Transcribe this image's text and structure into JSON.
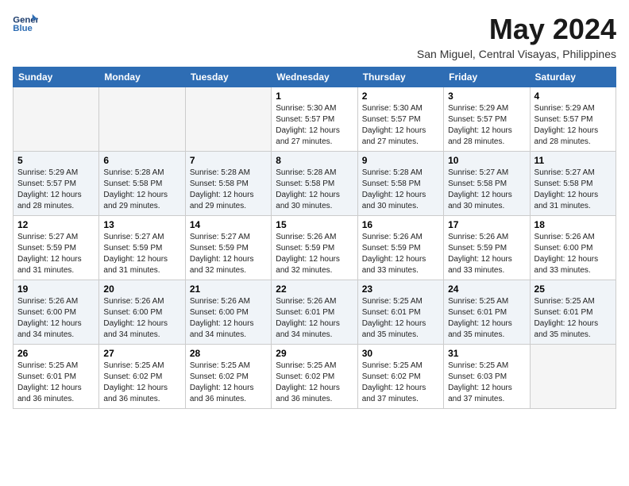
{
  "logo": {
    "line1": "General",
    "line2": "Blue"
  },
  "title": "May 2024",
  "subtitle": "San Miguel, Central Visayas, Philippines",
  "weekdays": [
    "Sunday",
    "Monday",
    "Tuesday",
    "Wednesday",
    "Thursday",
    "Friday",
    "Saturday"
  ],
  "weeks": [
    [
      {
        "day": "",
        "info": ""
      },
      {
        "day": "",
        "info": ""
      },
      {
        "day": "",
        "info": ""
      },
      {
        "day": "1",
        "info": "Sunrise: 5:30 AM\nSunset: 5:57 PM\nDaylight: 12 hours\nand 27 minutes."
      },
      {
        "day": "2",
        "info": "Sunrise: 5:30 AM\nSunset: 5:57 PM\nDaylight: 12 hours\nand 27 minutes."
      },
      {
        "day": "3",
        "info": "Sunrise: 5:29 AM\nSunset: 5:57 PM\nDaylight: 12 hours\nand 28 minutes."
      },
      {
        "day": "4",
        "info": "Sunrise: 5:29 AM\nSunset: 5:57 PM\nDaylight: 12 hours\nand 28 minutes."
      }
    ],
    [
      {
        "day": "5",
        "info": "Sunrise: 5:29 AM\nSunset: 5:57 PM\nDaylight: 12 hours\nand 28 minutes."
      },
      {
        "day": "6",
        "info": "Sunrise: 5:28 AM\nSunset: 5:58 PM\nDaylight: 12 hours\nand 29 minutes."
      },
      {
        "day": "7",
        "info": "Sunrise: 5:28 AM\nSunset: 5:58 PM\nDaylight: 12 hours\nand 29 minutes."
      },
      {
        "day": "8",
        "info": "Sunrise: 5:28 AM\nSunset: 5:58 PM\nDaylight: 12 hours\nand 30 minutes."
      },
      {
        "day": "9",
        "info": "Sunrise: 5:28 AM\nSunset: 5:58 PM\nDaylight: 12 hours\nand 30 minutes."
      },
      {
        "day": "10",
        "info": "Sunrise: 5:27 AM\nSunset: 5:58 PM\nDaylight: 12 hours\nand 30 minutes."
      },
      {
        "day": "11",
        "info": "Sunrise: 5:27 AM\nSunset: 5:58 PM\nDaylight: 12 hours\nand 31 minutes."
      }
    ],
    [
      {
        "day": "12",
        "info": "Sunrise: 5:27 AM\nSunset: 5:59 PM\nDaylight: 12 hours\nand 31 minutes."
      },
      {
        "day": "13",
        "info": "Sunrise: 5:27 AM\nSunset: 5:59 PM\nDaylight: 12 hours\nand 31 minutes."
      },
      {
        "day": "14",
        "info": "Sunrise: 5:27 AM\nSunset: 5:59 PM\nDaylight: 12 hours\nand 32 minutes."
      },
      {
        "day": "15",
        "info": "Sunrise: 5:26 AM\nSunset: 5:59 PM\nDaylight: 12 hours\nand 32 minutes."
      },
      {
        "day": "16",
        "info": "Sunrise: 5:26 AM\nSunset: 5:59 PM\nDaylight: 12 hours\nand 33 minutes."
      },
      {
        "day": "17",
        "info": "Sunrise: 5:26 AM\nSunset: 5:59 PM\nDaylight: 12 hours\nand 33 minutes."
      },
      {
        "day": "18",
        "info": "Sunrise: 5:26 AM\nSunset: 6:00 PM\nDaylight: 12 hours\nand 33 minutes."
      }
    ],
    [
      {
        "day": "19",
        "info": "Sunrise: 5:26 AM\nSunset: 6:00 PM\nDaylight: 12 hours\nand 34 minutes."
      },
      {
        "day": "20",
        "info": "Sunrise: 5:26 AM\nSunset: 6:00 PM\nDaylight: 12 hours\nand 34 minutes."
      },
      {
        "day": "21",
        "info": "Sunrise: 5:26 AM\nSunset: 6:00 PM\nDaylight: 12 hours\nand 34 minutes."
      },
      {
        "day": "22",
        "info": "Sunrise: 5:26 AM\nSunset: 6:01 PM\nDaylight: 12 hours\nand 34 minutes."
      },
      {
        "day": "23",
        "info": "Sunrise: 5:25 AM\nSunset: 6:01 PM\nDaylight: 12 hours\nand 35 minutes."
      },
      {
        "day": "24",
        "info": "Sunrise: 5:25 AM\nSunset: 6:01 PM\nDaylight: 12 hours\nand 35 minutes."
      },
      {
        "day": "25",
        "info": "Sunrise: 5:25 AM\nSunset: 6:01 PM\nDaylight: 12 hours\nand 35 minutes."
      }
    ],
    [
      {
        "day": "26",
        "info": "Sunrise: 5:25 AM\nSunset: 6:01 PM\nDaylight: 12 hours\nand 36 minutes."
      },
      {
        "day": "27",
        "info": "Sunrise: 5:25 AM\nSunset: 6:02 PM\nDaylight: 12 hours\nand 36 minutes."
      },
      {
        "day": "28",
        "info": "Sunrise: 5:25 AM\nSunset: 6:02 PM\nDaylight: 12 hours\nand 36 minutes."
      },
      {
        "day": "29",
        "info": "Sunrise: 5:25 AM\nSunset: 6:02 PM\nDaylight: 12 hours\nand 36 minutes."
      },
      {
        "day": "30",
        "info": "Sunrise: 5:25 AM\nSunset: 6:02 PM\nDaylight: 12 hours\nand 37 minutes."
      },
      {
        "day": "31",
        "info": "Sunrise: 5:25 AM\nSunset: 6:03 PM\nDaylight: 12 hours\nand 37 minutes."
      },
      {
        "day": "",
        "info": ""
      }
    ]
  ]
}
